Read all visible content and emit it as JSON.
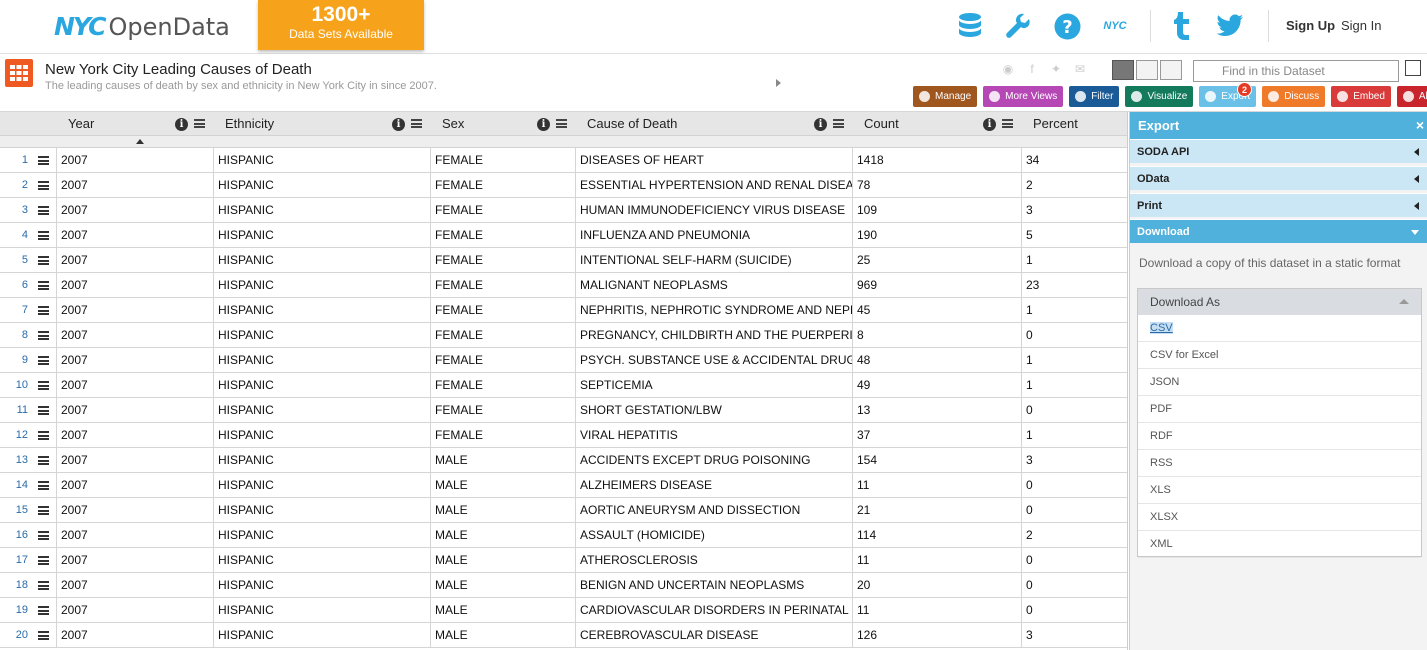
{
  "header": {
    "logo_nyc": "NYC",
    "logo_opendata": "OpenData",
    "badge_number": "1300+",
    "badge_text": "Data Sets Available",
    "signup": "Sign Up",
    "signin": "Sign In",
    "nyc_small": "NYC"
  },
  "dataset": {
    "title": "New York City Leading Causes of Death",
    "subtitle": "The leading causes of death by sex and ethnicity in New York City in since 2007.",
    "find_placeholder": "Find in this Dataset"
  },
  "actions": [
    {
      "label": "Manage",
      "color": "#a0561f"
    },
    {
      "label": "More Views",
      "color": "#b648b6"
    },
    {
      "label": "Filter",
      "color": "#1a5a96"
    },
    {
      "label": "Visualize",
      "color": "#147a5c"
    },
    {
      "label": "Export",
      "color": "#6bc0e8"
    },
    {
      "label": "Discuss",
      "color": "#ef7a2a"
    },
    {
      "label": "Embed",
      "color": "#d93b3b"
    },
    {
      "label": "About",
      "color": "#c8262c"
    }
  ],
  "discuss_count": "2",
  "grid": {
    "columns": [
      "Year",
      "Ethnicity",
      "Sex",
      "Cause of Death",
      "Count",
      "Percent"
    ],
    "rows": [
      [
        "1",
        "2007",
        "HISPANIC",
        "FEMALE",
        "DISEASES OF HEART",
        "1418",
        "34"
      ],
      [
        "2",
        "2007",
        "HISPANIC",
        "FEMALE",
        "ESSENTIAL HYPERTENSION AND RENAL DISEASES",
        "78",
        "2"
      ],
      [
        "3",
        "2007",
        "HISPANIC",
        "FEMALE",
        "HUMAN IMMUNODEFICIENCY VIRUS DISEASE",
        "109",
        "3"
      ],
      [
        "4",
        "2007",
        "HISPANIC",
        "FEMALE",
        "INFLUENZA AND PNEUMONIA",
        "190",
        "5"
      ],
      [
        "5",
        "2007",
        "HISPANIC",
        "FEMALE",
        "INTENTIONAL SELF-HARM (SUICIDE)",
        "25",
        "1"
      ],
      [
        "6",
        "2007",
        "HISPANIC",
        "FEMALE",
        "MALIGNANT NEOPLASMS",
        "969",
        "23"
      ],
      [
        "7",
        "2007",
        "HISPANIC",
        "FEMALE",
        "NEPHRITIS, NEPHROTIC SYNDROME AND NEPHROSIS",
        "45",
        "1"
      ],
      [
        "8",
        "2007",
        "HISPANIC",
        "FEMALE",
        "PREGNANCY, CHILDBIRTH AND THE PUERPERIUM",
        "8",
        "0"
      ],
      [
        "9",
        "2007",
        "HISPANIC",
        "FEMALE",
        "PSYCH. SUBSTANCE USE & ACCIDENTAL DRUG POISONING",
        "48",
        "1"
      ],
      [
        "10",
        "2007",
        "HISPANIC",
        "FEMALE",
        "SEPTICEMIA",
        "49",
        "1"
      ],
      [
        "11",
        "2007",
        "HISPANIC",
        "FEMALE",
        "SHORT GESTATION/LBW",
        "13",
        "0"
      ],
      [
        "12",
        "2007",
        "HISPANIC",
        "FEMALE",
        "VIRAL HEPATITIS",
        "37",
        "1"
      ],
      [
        "13",
        "2007",
        "HISPANIC",
        "MALE",
        "ACCIDENTS EXCEPT DRUG POISONING",
        "154",
        "3"
      ],
      [
        "14",
        "2007",
        "HISPANIC",
        "MALE",
        "ALZHEIMERS DISEASE",
        "11",
        "0"
      ],
      [
        "15",
        "2007",
        "HISPANIC",
        "MALE",
        "AORTIC ANEURYSM AND DISSECTION",
        "21",
        "0"
      ],
      [
        "16",
        "2007",
        "HISPANIC",
        "MALE",
        "ASSAULT (HOMICIDE)",
        "114",
        "2"
      ],
      [
        "17",
        "2007",
        "HISPANIC",
        "MALE",
        "ATHEROSCLEROSIS",
        "11",
        "0"
      ],
      [
        "18",
        "2007",
        "HISPANIC",
        "MALE",
        "BENIGN AND UNCERTAIN NEOPLASMS",
        "20",
        "0"
      ],
      [
        "19",
        "2007",
        "HISPANIC",
        "MALE",
        "CARDIOVASCULAR DISORDERS IN PERINATAL PERIOD",
        "11",
        "0"
      ],
      [
        "20",
        "2007",
        "HISPANIC",
        "MALE",
        "CEREBROVASCULAR DISEASE",
        "126",
        "3"
      ]
    ]
  },
  "panel": {
    "title": "Export",
    "close": "×",
    "sections": [
      "SODA API",
      "OData",
      "Print",
      "Download"
    ],
    "description": "Download a copy of this dataset in a static format",
    "download_as": "Download As",
    "formats": [
      "CSV",
      "CSV for Excel",
      "JSON",
      "PDF",
      "RDF",
      "RSS",
      "XLS",
      "XLSX",
      "XML"
    ],
    "selected_format": "CSV"
  },
  "icons": [
    "database-icon",
    "wrench-icon",
    "help-icon",
    "nyc-icon",
    "tumblr-icon",
    "twitter-icon"
  ]
}
